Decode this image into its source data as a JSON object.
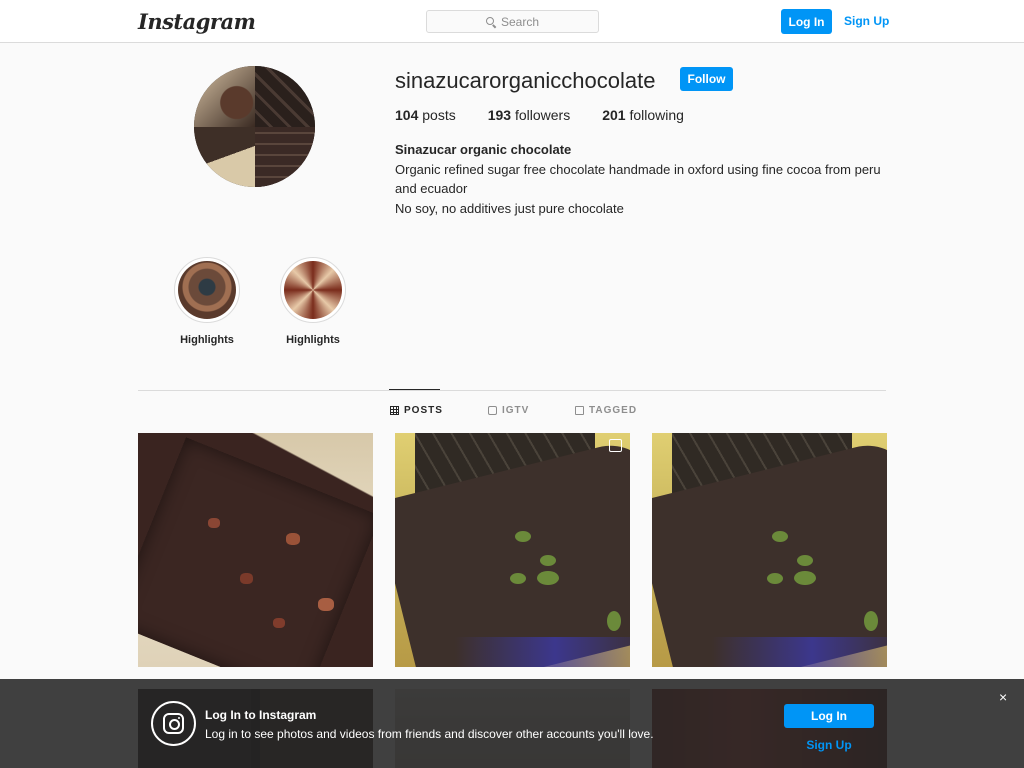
{
  "nav": {
    "logo": "Instagram",
    "search_placeholder": "Search",
    "login_label": "Log In",
    "signup_label": "Sign Up"
  },
  "profile": {
    "username": "sinazucarorganicchocolate",
    "follow_label": "Follow",
    "posts_count": "104",
    "posts_label": "posts",
    "followers_count": "193",
    "followers_label": "followers",
    "following_count": "201",
    "following_label": "following",
    "full_name": "Sinazucar organic chocolate",
    "bio_line1": "Organic refined sugar free chocolate handmade in oxford using fine cocoa from peru and ecuador",
    "bio_line2": "No soy, no additives just pure chocolate"
  },
  "highlights": [
    {
      "label": "Highlights"
    },
    {
      "label": "Highlights"
    }
  ],
  "tabs": [
    {
      "label": "POSTS",
      "icon": "grid-icon",
      "active": true
    },
    {
      "label": "IGTV",
      "icon": "igtv-icon",
      "active": false
    },
    {
      "label": "TAGGED",
      "icon": "tagged-icon",
      "active": false
    }
  ],
  "overlay": {
    "title": "Log In to Instagram",
    "text": "Log in to see photos and videos from friends and discover other accounts you'll love.",
    "login_label": "Log In",
    "signup_label": "Sign Up",
    "close_glyph": "×"
  },
  "colors": {
    "accent": "#0095f6",
    "border": "#dbdbdb",
    "text": "#262626",
    "muted": "#8e8e8e"
  }
}
